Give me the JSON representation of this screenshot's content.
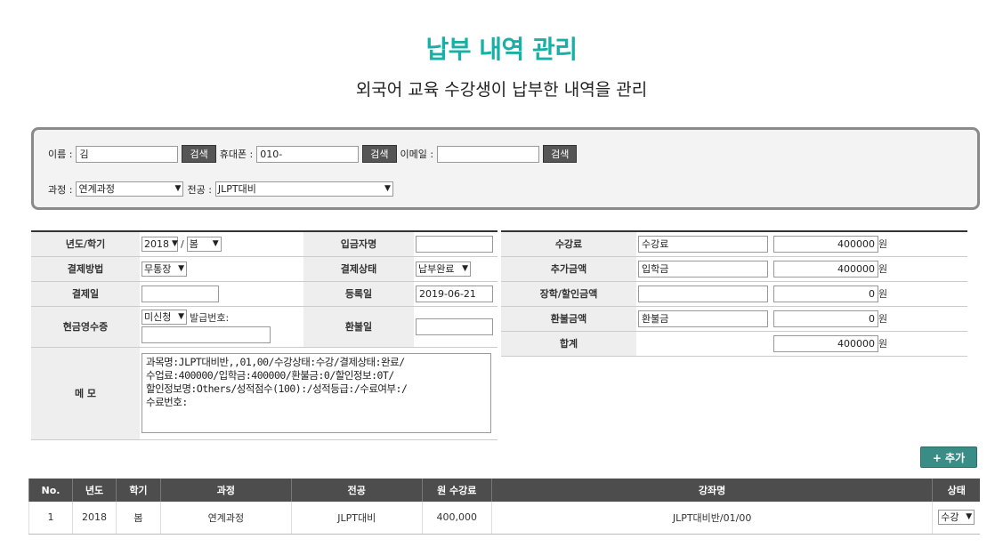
{
  "header": {
    "title": "납부 내역 관리",
    "subtitle": "외국어 교육 수강생이 납부한 내역을 관리"
  },
  "search": {
    "name_label": "이름 :",
    "name_value": "김",
    "phone_label": "휴대폰 :",
    "phone_value": "010-",
    "email_label": "이메일 :",
    "email_value": "",
    "search_button": "검색",
    "course_label": "과정 :",
    "course_value": "연계과정",
    "major_label": "전공 :",
    "major_value": "JLPT대비"
  },
  "form": {
    "year_label": "년도/학기",
    "year_value": "2018",
    "slash": "/",
    "term_value": "봄",
    "depositor_label": "입금자명",
    "depositor_value": "",
    "method_label": "결제방법",
    "method_value": "무통장",
    "status_label": "결제상태",
    "status_value": "납부완료",
    "paydate_label": "결제일",
    "paydate_value": "",
    "regdate_label": "등록일",
    "regdate_value": "2019-06-21",
    "receipt_label": "현금영수증",
    "receipt_value": "미신청",
    "issue_label": "발급번호:",
    "issue_value": "",
    "refunddate_label": "환불일",
    "refunddate_value": "",
    "memo_label": "메 모",
    "memo_value": "과목명:JLPT대비반,,01,00/수강상태:수강/결제상태:완료/\n수업료:400000/입학금:400000/환불금:0/할인정보:0T/\n할인정보명:Others/성적점수(100):/성적등급:/수료여부:/\n수료번호:"
  },
  "fees": {
    "tuition_label": "수강료",
    "tuition_name": "수강료",
    "tuition_amount": "400000",
    "extra_label": "추가금액",
    "extra_name": "입학금",
    "extra_amount": "400000",
    "discount_label": "장학/할인금액",
    "discount_name": "",
    "discount_amount": "0",
    "refund_label": "환불금액",
    "refund_name": "환불금",
    "refund_amount": "0",
    "total_label": "합계",
    "total_amount": "400000",
    "won": "원"
  },
  "add_button": "+ 추가",
  "list": {
    "headers": [
      "No.",
      "년도",
      "학기",
      "과정",
      "전공",
      "원 수강료",
      "강좌명",
      "상태"
    ],
    "rows": [
      {
        "no": "1",
        "year": "2018",
        "term": "봄",
        "course": "연계과정",
        "major": "JLPT대비",
        "fee": "400,000",
        "lecture": "JLPT대비반/01/00",
        "status": "수강"
      }
    ]
  },
  "colors": {
    "title": "#18b0a6",
    "header_bg": "#4d4d4d",
    "add_button": "#3a8c86",
    "fee_text": "#1a1acc"
  }
}
